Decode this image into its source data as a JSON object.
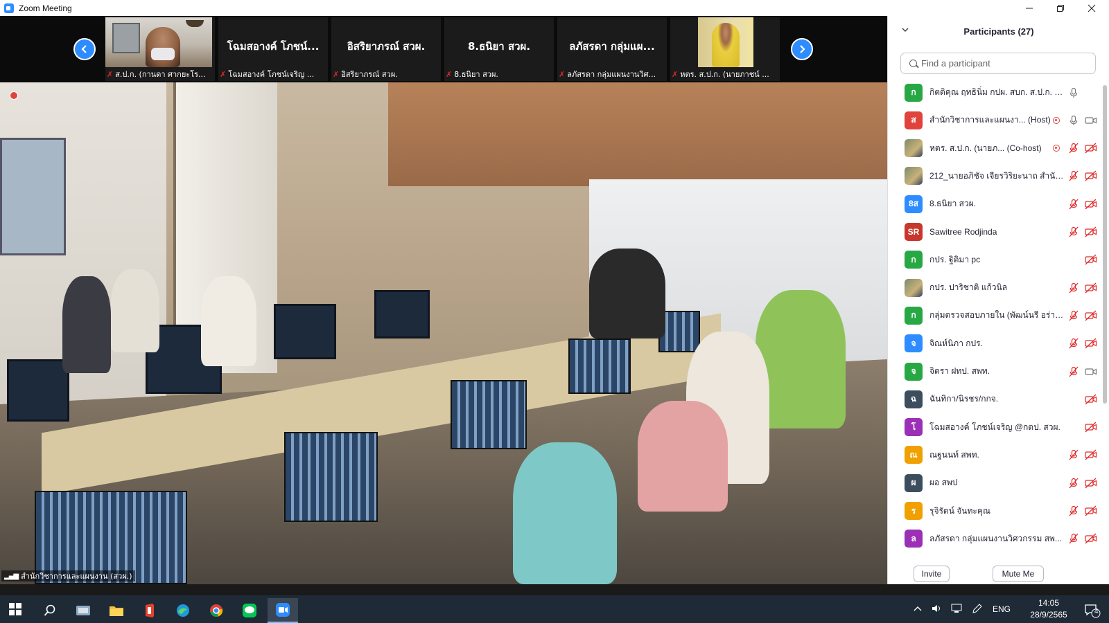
{
  "window": {
    "title": "Zoom Meeting",
    "controls": [
      "minimize",
      "maximize",
      "close"
    ]
  },
  "strip": {
    "tiles": [
      {
        "big_name": "",
        "caption": "ส.ป.ก. (กานดา ศากยะโร..."
      },
      {
        "big_name": "โฉมสอางค์ โภชน์...",
        "caption": "โฉมสอางค์ โภชน์เจริญ ..."
      },
      {
        "big_name": "อิสริยาภรณ์ สวผ.",
        "caption": "อิสริยาภรณ์ สวผ."
      },
      {
        "big_name": "8.ธนิยา สวผ.",
        "caption": "8.ธนิยา สวผ."
      },
      {
        "big_name": "ลภัสรดา กลุ่มแผ...",
        "caption": "ลภัสรดา กลุ่มแผนงานวิศ..."
      },
      {
        "big_name": "",
        "caption": "หตร. ส.ป.ก. (นายภาชน์ ..."
      }
    ]
  },
  "main_video": {
    "caption": "สำนักวิชาการและแผนงาน (สวผ.)"
  },
  "participants": {
    "title": "Participants (27)",
    "search_placeholder": "Find a participant",
    "items": [
      {
        "initials": "ก",
        "color": "#27a844",
        "name": "กิตติคุณ ฤทธินิ่ม กปผ. สบก. ส.ป.ก. (Me)",
        "photo": false,
        "rec": false,
        "mic": "on",
        "video": "none"
      },
      {
        "initials": "ส",
        "color": "#e0433b",
        "name": "สำนักวิชาการและแผนงา... (Host)",
        "photo": false,
        "rec": true,
        "mic": "on",
        "video": "on"
      },
      {
        "initials": "",
        "color": "#7d8a6a",
        "name": "หตร. ส.ป.ก. (นายภ... (Co-host)",
        "photo": true,
        "rec": true,
        "mic": "off",
        "video": "off"
      },
      {
        "initials": "",
        "color": "#9a7a5a",
        "name": "212_นายอภิชัจ เจียรวิริยะนาถ สำนัก...",
        "photo": true,
        "rec": false,
        "mic": "off",
        "video": "off"
      },
      {
        "initials": "8ส",
        "color": "#2d8cff",
        "name": "8.ธนิยา สวผ.",
        "photo": false,
        "rec": false,
        "mic": "off",
        "video": "off"
      },
      {
        "initials": "SR",
        "color": "#c8372d",
        "name": "Sawitree Rodjinda",
        "photo": false,
        "rec": false,
        "mic": "off",
        "video": "off"
      },
      {
        "initials": "ก",
        "color": "#27a844",
        "name": "กปร. ฐิติมา pc",
        "photo": false,
        "rec": false,
        "mic": "none",
        "video": "off"
      },
      {
        "initials": "",
        "color": "#4a6a8a",
        "name": "กปร. ปาริชาติ แก้วนิล",
        "photo": true,
        "rec": false,
        "mic": "off",
        "video": "off"
      },
      {
        "initials": "ก",
        "color": "#27a844",
        "name": "กลุ่มตรวจสอบภายใน (พัฒน์นรี อร่าม...",
        "photo": false,
        "rec": false,
        "mic": "off",
        "video": "off"
      },
      {
        "initials": "จ",
        "color": "#2d8cff",
        "name": "จิณห์นิภา กปร.",
        "photo": false,
        "rec": false,
        "mic": "off",
        "video": "off"
      },
      {
        "initials": "จ",
        "color": "#27a844",
        "name": "จิตรา ฝทป. สพท.",
        "photo": false,
        "rec": false,
        "mic": "off",
        "video": "on"
      },
      {
        "initials": "ฉ",
        "color": "#3c4d5e",
        "name": "ฉันทิกา/นิรชร/กกจ.",
        "photo": false,
        "rec": false,
        "mic": "none",
        "video": "off"
      },
      {
        "initials": "โ",
        "color": "#9b2fb5",
        "name": "โฉมสอางค์ โภชน์เจริญ @กตป. สวผ.",
        "photo": false,
        "rec": false,
        "mic": "none",
        "video": "off"
      },
      {
        "initials": "ณ",
        "color": "#f0a000",
        "name": "ณฐนนท์ สพท.",
        "photo": false,
        "rec": false,
        "mic": "off",
        "video": "off"
      },
      {
        "initials": "ผ",
        "color": "#3c4d5e",
        "name": "ผอ สพป",
        "photo": false,
        "rec": false,
        "mic": "off",
        "video": "off"
      },
      {
        "initials": "ร",
        "color": "#f0a000",
        "name": "รุจิรัตน์ จันทะคุณ",
        "photo": false,
        "rec": false,
        "mic": "off",
        "video": "off"
      },
      {
        "initials": "ล",
        "color": "#9b2fb5",
        "name": "ลภัสรดา กลุ่มแผนงานวิศวกรรม สพ...",
        "photo": false,
        "rec": false,
        "mic": "off",
        "video": "off"
      }
    ],
    "invite_label": "Invite",
    "mute_me_label": "Mute Me"
  },
  "taskbar": {
    "apps": [
      "search-icon",
      "explorer-icon",
      "file-manager-icon",
      "office-icon",
      "edge-icon",
      "chrome-icon",
      "line-icon",
      "zoom-icon"
    ],
    "active_app": "zoom-icon",
    "language": "ENG",
    "time": "14:05",
    "date": "28/9/2565",
    "notification_count": "4"
  },
  "colors": {
    "zoom_blue": "#2d8cff",
    "mic_off_red": "#e02828",
    "taskbar_bg": "#1f2a37"
  }
}
